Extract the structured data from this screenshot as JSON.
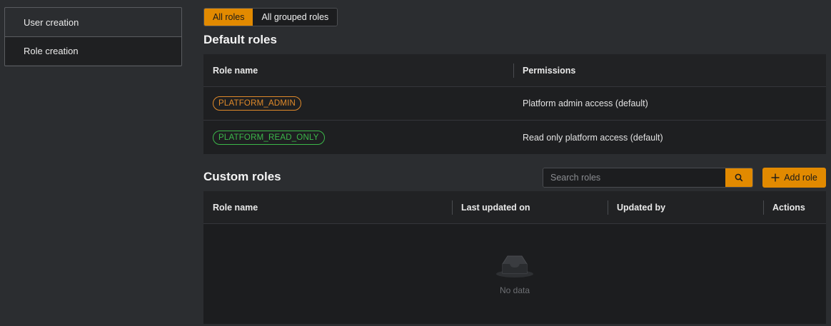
{
  "sidebar": {
    "items": [
      {
        "label": "User creation"
      },
      {
        "label": "Role creation"
      }
    ]
  },
  "tabs": [
    {
      "label": "All roles",
      "active": true
    },
    {
      "label": "All grouped roles",
      "active": false
    }
  ],
  "default_roles": {
    "title": "Default roles",
    "columns": [
      "Role name",
      "Permissions"
    ],
    "rows": [
      {
        "role": "PLATFORM_ADMIN",
        "permission": "Platform admin access (default)",
        "color": "#e08a2a"
      },
      {
        "role": "PLATFORM_READ_ONLY",
        "permission": "Read only platform access (default)",
        "color": "#3cb84a"
      }
    ]
  },
  "custom_roles": {
    "title": "Custom roles",
    "search_placeholder": "Search roles",
    "add_label": "Add role",
    "columns": [
      "Role name",
      "Last updated on",
      "Updated by",
      "Actions"
    ],
    "empty_text": "No data"
  },
  "colors": {
    "accent": "#e28a00",
    "background": "#2b2d30",
    "table_bg": "#1e1f21"
  },
  "icons": {
    "search": "search-icon",
    "add": "plus-icon",
    "empty": "empty-inbox-icon"
  }
}
